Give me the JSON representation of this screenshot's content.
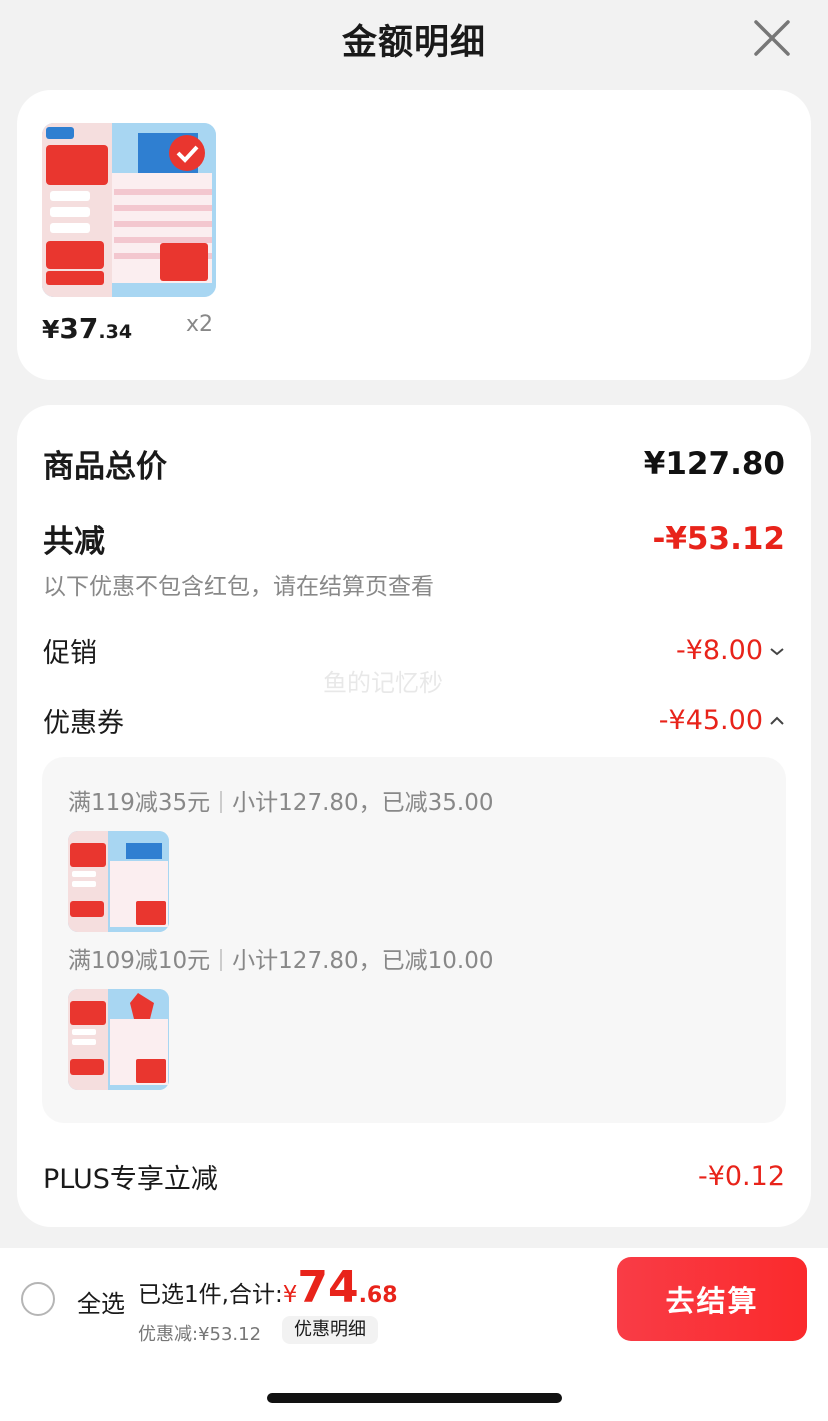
{
  "header": {
    "title": "金额明细",
    "close_icon": "close-icon"
  },
  "product": {
    "currency": "¥",
    "price_int": "37",
    "price_dec": ".34",
    "quantity": "x2"
  },
  "summary": {
    "total_label": "商品总价",
    "total_value": "¥127.80",
    "reduce_label": "共减",
    "reduce_value": "-¥53.12",
    "note": "以下优惠不包含红包，请在结算页查看",
    "promo_label": "促销",
    "promo_value": "-¥8.00",
    "coupon_label": "优惠券",
    "coupon_value": "-¥45.00",
    "plus_label": "PLUS专享立减",
    "plus_value": "-¥0.12",
    "watermark": "鱼的记忆秒"
  },
  "coupons": [
    {
      "rule": "满119减35元",
      "detail": "小计127.80，已减35.00"
    },
    {
      "rule": "满109减10元",
      "detail": "小计127.80，已减10.00"
    }
  ],
  "bottom_bar": {
    "select_all": "全选",
    "selected_text": "已选1件,合计:",
    "currency": "¥",
    "total_int": "74",
    "total_dec": ".68",
    "discount_text": "优惠减:¥53.12",
    "discount_detail_button": "优惠明细",
    "checkout_button": "去结算"
  },
  "colors": {
    "accent_red": "#e8231a",
    "checkout_bg": "#fa2a2c"
  }
}
